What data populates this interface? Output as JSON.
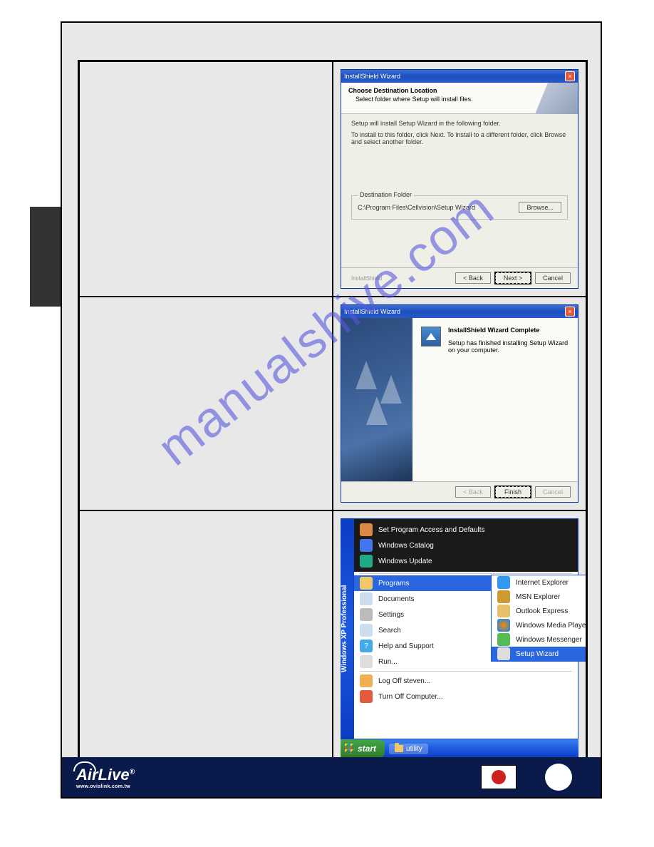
{
  "watermark": "manualshive.com",
  "dialog1": {
    "title": "InstallShield Wizard",
    "header_title": "Choose Destination Location",
    "header_sub": "Select folder where Setup will install files.",
    "body_line1": "Setup will install Setup Wizard in the following folder.",
    "body_line2": "To install to this folder, click Next. To install to a different folder, click Browse and select another folder.",
    "dest_legend": "Destination Folder",
    "dest_path": "C:\\Program Files\\Cellvision\\Setup Wizard",
    "browse": "Browse...",
    "shield": "InstallShield",
    "back": "< Back",
    "next": "Next >",
    "cancel": "Cancel"
  },
  "dialog2": {
    "title": "InstallShield Wizard",
    "header_title": "InstallShield Wizard Complete",
    "body": "Setup has finished installing Setup Wizard on your computer.",
    "back": "< Back",
    "finish": "Finish",
    "cancel": "Cancel"
  },
  "startmenu": {
    "sidebar": "Windows XP Professional",
    "top": [
      {
        "label": "Set Program Access and Defaults",
        "icon": "shield"
      },
      {
        "label": "Windows Catalog",
        "icon": "flag"
      },
      {
        "label": "Windows Update",
        "icon": "globe"
      }
    ],
    "items": [
      {
        "label": "Programs",
        "icon": "folder",
        "arrow": true,
        "sel": true
      },
      {
        "label": "Documents",
        "icon": "doc",
        "arrow": true
      },
      {
        "label": "Settings",
        "icon": "settings",
        "arrow": true
      },
      {
        "label": "Search",
        "icon": "search",
        "arrow": true
      },
      {
        "label": "Help and Support",
        "icon": "help"
      },
      {
        "label": "Run...",
        "icon": "run"
      }
    ],
    "bottom": [
      {
        "label": "Log Off steven...",
        "icon": "logoff"
      },
      {
        "label": "Turn Off Computer...",
        "icon": "shutdown"
      }
    ],
    "submenu": [
      {
        "label": "Internet Explorer",
        "icon": "ie"
      },
      {
        "label": "MSN Explorer",
        "icon": "msn"
      },
      {
        "label": "Outlook Express",
        "icon": "outlook"
      },
      {
        "label": "Windows Media Player",
        "icon": "wmp"
      },
      {
        "label": "Windows Messenger",
        "icon": "msgr"
      },
      {
        "label": "Setup Wizard",
        "icon": "setup",
        "sel": true
      }
    ],
    "start": "start",
    "task": "utility"
  },
  "footer": {
    "logo": "AirLive",
    "url": "www.ovislink.com.tw"
  }
}
